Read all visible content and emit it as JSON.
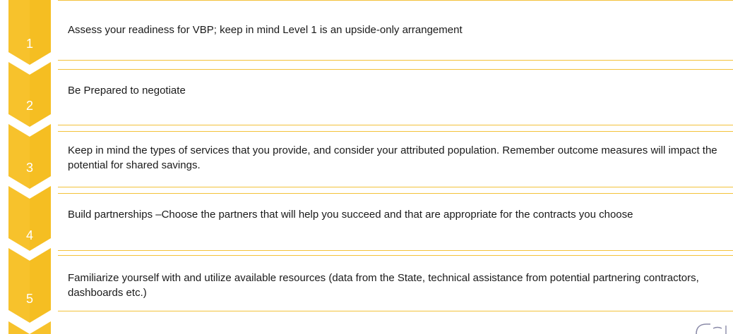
{
  "steps": [
    {
      "number": "1",
      "text": "Assess your readiness for VBP; keep in mind Level 1 is an upside-only arrangement"
    },
    {
      "number": "2",
      "text": "Be Prepared to negotiate"
    },
    {
      "number": "3",
      "text": "Keep in mind the types of services that you provide, and consider your attributed population. Remember outcome measures will impact the potential for shared savings."
    },
    {
      "number": "4",
      "text": "Build partnerships –Choose the partners that will help you succeed and that are appropriate for the contracts you choose"
    },
    {
      "number": "5",
      "text": "Familiarize yourself with and utilize available resources (data from the State, technical assistance from potential partnering contractors, dashboards etc.)"
    }
  ],
  "colors": {
    "chevron": "#f7c22c",
    "chevron_dark": "#f2b712",
    "border": "#f3c23a",
    "text": "#1a1a1a"
  },
  "icons": {
    "chevron": "chevron-down-arrow",
    "logo": "partial-logo-mark"
  }
}
